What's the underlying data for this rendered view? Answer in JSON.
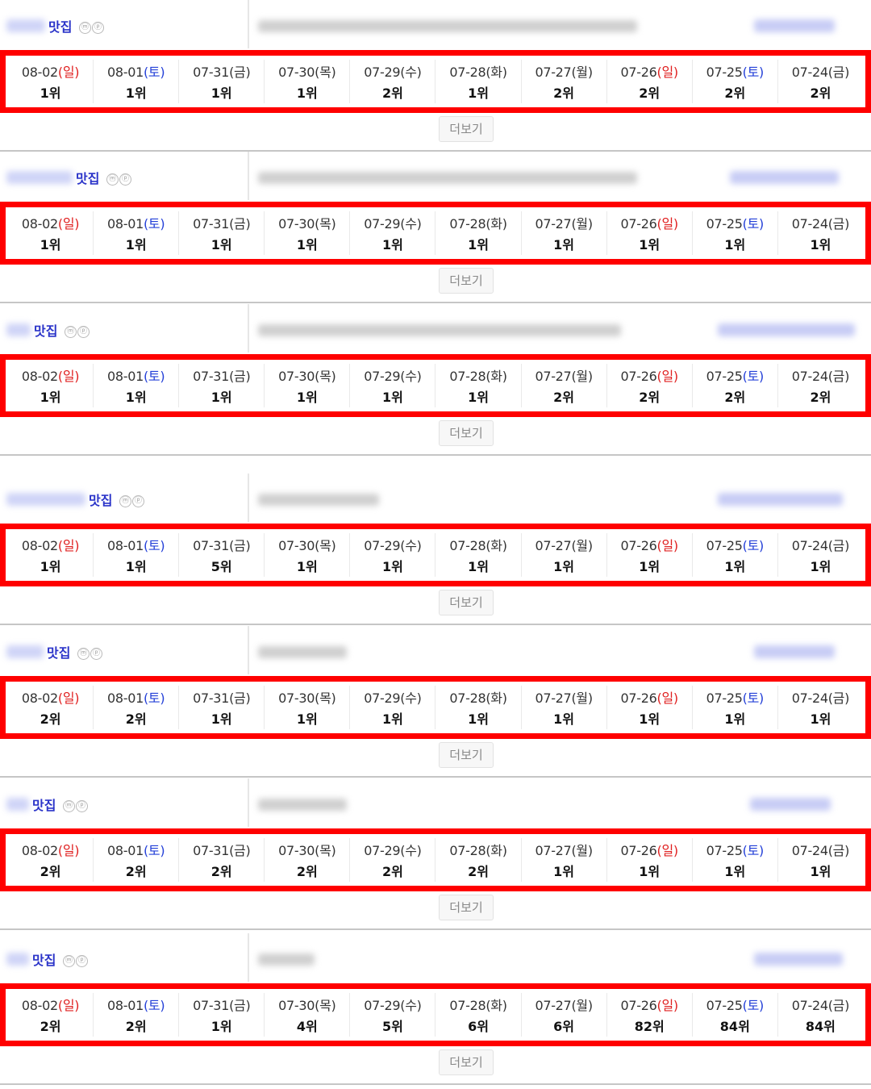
{
  "more_label": "더보기",
  "badge_labels": [
    "ⓜ",
    "ⓟ"
  ],
  "colors": {
    "highlight": "#ff0000",
    "keyword": "#2b34c9",
    "sunday": "#e02020",
    "saturday": "#2440d8"
  },
  "dates": [
    {
      "date": "08-02",
      "open": "(",
      "day": "일",
      "close": ")",
      "tone": "red"
    },
    {
      "date": "08-01",
      "open": "(",
      "day": "토",
      "close": ")",
      "tone": "blue"
    },
    {
      "date": "07-31",
      "open": "(",
      "day": "금",
      "close": ")",
      "tone": "gray"
    },
    {
      "date": "07-30",
      "open": "(",
      "day": "목",
      "close": ")",
      "tone": "gray"
    },
    {
      "date": "07-29",
      "open": "(",
      "day": "수",
      "close": ")",
      "tone": "gray"
    },
    {
      "date": "07-28",
      "open": "(",
      "day": "화",
      "close": ")",
      "tone": "gray"
    },
    {
      "date": "07-27",
      "open": "(",
      "day": "월",
      "close": ")",
      "tone": "gray"
    },
    {
      "date": "07-26",
      "open": "(",
      "day": "일",
      "close": ")",
      "tone": "red"
    },
    {
      "date": "07-25",
      "open": "(",
      "day": "토",
      "close": ")",
      "tone": "blue"
    },
    {
      "date": "07-24",
      "open": "(",
      "day": "금",
      "close": ")",
      "tone": "gray"
    }
  ],
  "entries": [
    {
      "keyword": "맛집",
      "ranks": [
        "1위",
        "1위",
        "1위",
        "1위",
        "2위",
        "1위",
        "2위",
        "2위",
        "2위",
        "2위"
      ]
    },
    {
      "keyword": "맛집",
      "ranks": [
        "1위",
        "1위",
        "1위",
        "1위",
        "1위",
        "1위",
        "1위",
        "1위",
        "1위",
        "1위"
      ]
    },
    {
      "keyword": "맛집",
      "ranks": [
        "1위",
        "1위",
        "1위",
        "1위",
        "1위",
        "1위",
        "2위",
        "2위",
        "2위",
        "2위"
      ]
    },
    {
      "keyword": "맛집",
      "ranks": [
        "1위",
        "1위",
        "5위",
        "1위",
        "1위",
        "1위",
        "1위",
        "1위",
        "1위",
        "1위"
      ]
    },
    {
      "keyword": "맛집",
      "ranks": [
        "2위",
        "2위",
        "1위",
        "1위",
        "1위",
        "1위",
        "1위",
        "1위",
        "1위",
        "1위"
      ]
    },
    {
      "keyword": "맛집",
      "ranks": [
        "2위",
        "2위",
        "2위",
        "2위",
        "2위",
        "2위",
        "1위",
        "1위",
        "1위",
        "1위"
      ]
    },
    {
      "keyword": "맛집",
      "ranks": [
        "2위",
        "2위",
        "1위",
        "4위",
        "5위",
        "6위",
        "6위",
        "82위",
        "84위",
        "84위"
      ]
    }
  ]
}
